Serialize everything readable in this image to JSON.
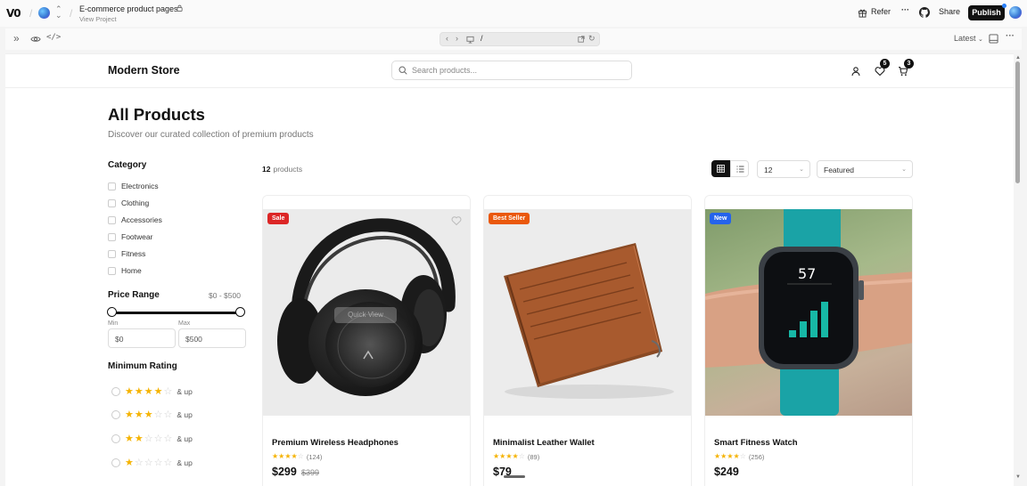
{
  "topbar": {
    "logo": "V0",
    "project_title": "E-commerce product pages",
    "project_link": "View Project",
    "refer": "Refer",
    "more": "···",
    "share": "Share",
    "publish": "Publish"
  },
  "toolbar": {
    "path": "/",
    "version": "Latest"
  },
  "store": {
    "brand": "Modern Store",
    "search_placeholder": "Search products...",
    "wishlist_count": "5",
    "cart_count": "3"
  },
  "page": {
    "title": "All Products",
    "subtitle": "Discover our curated collection of premium products"
  },
  "sidebar": {
    "category_heading": "Category",
    "categories": [
      "Electronics",
      "Clothing",
      "Accessories",
      "Footwear",
      "Fitness",
      "Home"
    ],
    "price_heading": "Price Range",
    "price_range_text": "$0 - $500",
    "min_label": "Min",
    "max_label": "Max",
    "min_value": "$0",
    "max_value": "$500",
    "rating_heading": "Minimum Rating",
    "ratings": [
      {
        "stars": 4,
        "label": "& up"
      },
      {
        "stars": 3,
        "label": "& up"
      },
      {
        "stars": 2,
        "label": "& up"
      },
      {
        "stars": 1,
        "label": "& up"
      }
    ]
  },
  "listing": {
    "count": "12",
    "count_label": "products",
    "per_page": "12",
    "sort": "Featured"
  },
  "products": [
    {
      "tag": "Sale",
      "tag_color": "#dc2626",
      "name": "Premium Wireless Headphones",
      "rating": 4,
      "reviews": "(124)",
      "price": "$299",
      "old_price": "$399",
      "quick_view": "Quick View"
    },
    {
      "tag": "Best Seller",
      "tag_color": "#ea580c",
      "name": "Minimalist Leather Wallet",
      "rating": 4,
      "reviews": "(89)",
      "price": "$79",
      "old_price": ""
    },
    {
      "tag": "New",
      "tag_color": "#2563eb",
      "name": "Smart Fitness Watch",
      "rating": 4,
      "reviews": "(256)",
      "price": "$249",
      "old_price": "",
      "watch_value": "57"
    }
  ]
}
